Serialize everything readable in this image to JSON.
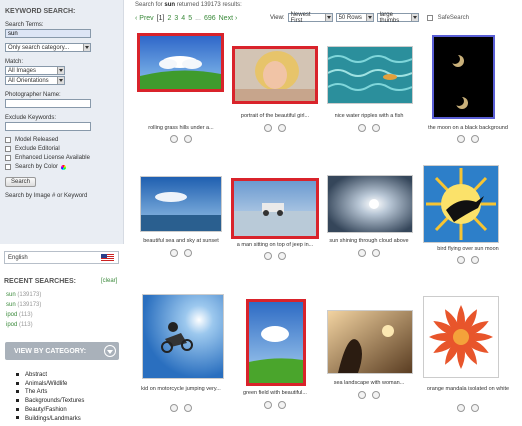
{
  "sidebar": {
    "keyword_title": "KEYWORD SEARCH:",
    "search_terms_label": "Search Terms:",
    "search_terms_value": "sun",
    "category_select": "Only search category...",
    "match_label": "Match:",
    "match_images": "All Images",
    "match_orientations": "All Orientations",
    "photographer_label": "Photographer Name:",
    "exclude_label": "Exclude Keywords:",
    "checkboxes": [
      "Model Released",
      "Exclude Editorial",
      "Enhanced License Available",
      "Search by Color"
    ],
    "search_button": "Search",
    "search_hint": "Search by Image # or Keyword",
    "language": "English",
    "recent_title": "RECENT SEARCHES:",
    "clear_label": "[clear]",
    "recent": [
      {
        "term": "sun",
        "count": "(139173)"
      },
      {
        "term": "sun",
        "count": "(139173)"
      },
      {
        "term": "ipod",
        "count": "(113)"
      },
      {
        "term": "ipod",
        "count": "(113)"
      }
    ],
    "category_banner": "VIEW BY CATEGORY:",
    "categories": [
      "Abstract",
      "Animals/Wildlife",
      "The Arts",
      "Backgrounds/Textures",
      "Beauty/Fashion",
      "Buildings/Landmarks"
    ]
  },
  "results": {
    "prefix": "Search for",
    "term": "sun",
    "middle": "returned",
    "count": "139173",
    "suffix": "results:"
  },
  "pager": {
    "prev": "‹ Prev",
    "current": "[1]",
    "pages": [
      "2",
      "3",
      "4",
      "5"
    ],
    "gap": "...",
    "last": "696",
    "next": "Next ›"
  },
  "view": {
    "label": "View:",
    "sort": "Newest First",
    "rows": "50 Rows",
    "size": "large thumbs",
    "safesearch": "SafeSearch"
  },
  "images": [
    {
      "caption": "rolling grass hills under a...",
      "icon": "sky-grass-photo"
    },
    {
      "caption": "portrait of the beautiful girl...",
      "icon": "portrait-photo"
    },
    {
      "caption": "nice water ripples with a fish",
      "icon": "water-photo"
    },
    {
      "caption": "the moon on a black background",
      "icon": "moon-photo"
    },
    {
      "caption": "beautiful sea and sky at sunset",
      "icon": "sea-sky-photo"
    },
    {
      "caption": "a man sitting on top of jeep in...",
      "icon": "jeep-photo"
    },
    {
      "caption": "sun shining through cloud above",
      "icon": "sun-cloud-photo"
    },
    {
      "caption": "bird flying over sun moon",
      "icon": "bird-sun-photo"
    },
    {
      "caption": "kid on motorcycle jumping very...",
      "icon": "motocross-photo"
    },
    {
      "caption": "green field with beautiful...",
      "icon": "green-field-photo"
    },
    {
      "caption": "sea landscape with woman...",
      "icon": "woman-sea-photo"
    },
    {
      "caption": "orange mandala isolated on white",
      "icon": "mandala-photo"
    }
  ],
  "colors": {
    "link_green": "#3b8a3b",
    "selected_border": "#d9232b",
    "sidebar_bg": "#e9edf3"
  }
}
